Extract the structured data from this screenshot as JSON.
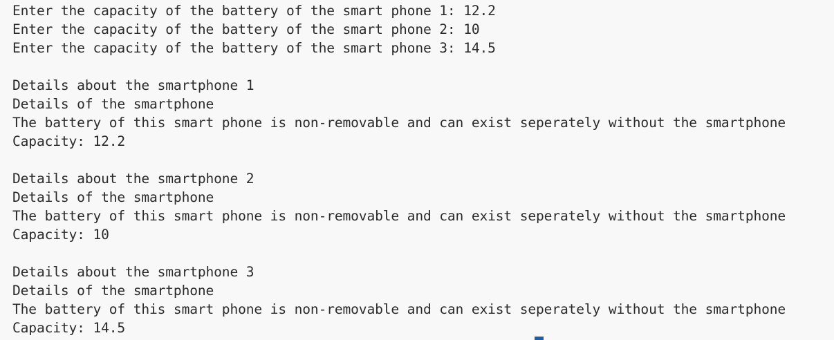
{
  "console": {
    "inputs": [
      "Enter the capacity of the battery of the smart phone 1: 12.2",
      "Enter the capacity of the battery of the smart phone 2: 10",
      "Enter the capacity of the battery of the smart phone 3: 14.5"
    ],
    "phones": [
      {
        "header": "Details about the smartphone 1",
        "subheader": "Details of the smartphone",
        "description": "The battery of this smart phone is non-removable and can exist seperately without the smartphone",
        "capacity": "Capacity: 12.2"
      },
      {
        "header": "Details about the smartphone 2",
        "subheader": "Details of the smartphone",
        "description": "The battery of this smart phone is non-removable and can exist seperately without the smartphone",
        "capacity": "Capacity: 10"
      },
      {
        "header": "Details about the smartphone 3",
        "subheader": "Details of the smartphone",
        "description": "The battery of this smart phone is non-removable and can exist seperately without the smartphone",
        "capacity": "Capacity: 14.5"
      }
    ]
  }
}
